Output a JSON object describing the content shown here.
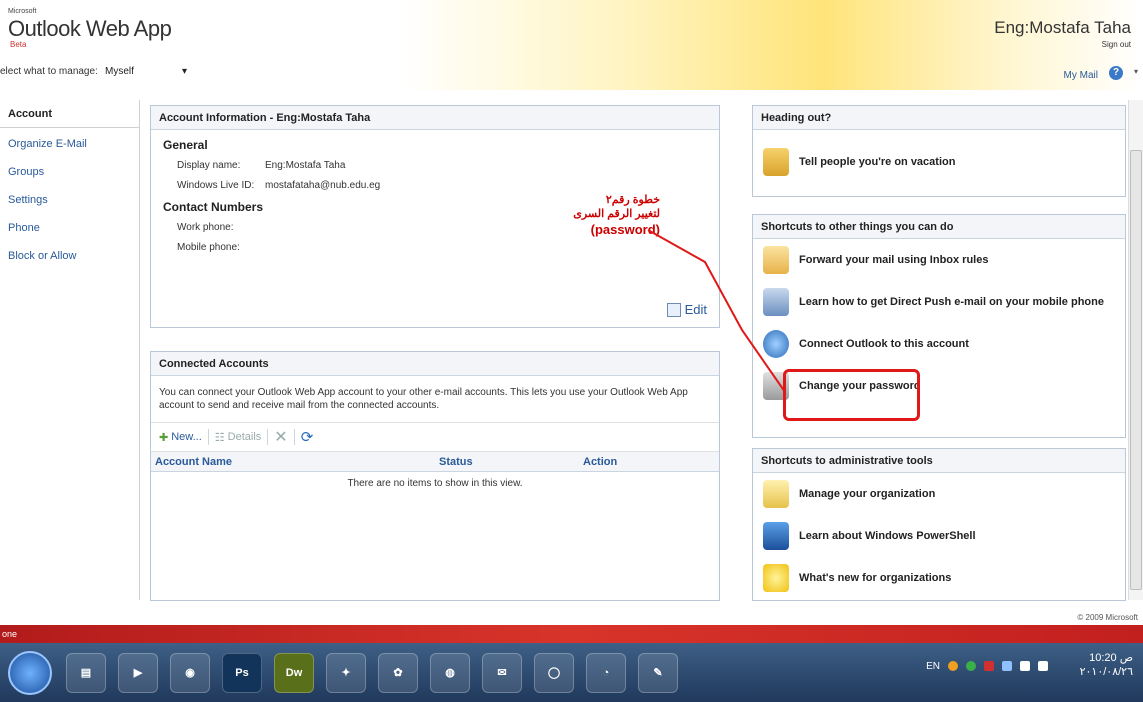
{
  "header": {
    "ms_label": "Microsoft",
    "app_title": "Outlook Web App",
    "beta": "Beta",
    "user_name": "Eng:Mostafa Taha",
    "sign_out": "Sign out",
    "manage_label": "elect what to manage:",
    "manage_value": "Myself",
    "my_mail": "My Mail"
  },
  "sidebar": {
    "items": [
      {
        "label": "Account"
      },
      {
        "label": "Organize E-Mail"
      },
      {
        "label": "Groups"
      },
      {
        "label": "Settings"
      },
      {
        "label": "Phone"
      },
      {
        "label": "Block or Allow"
      }
    ]
  },
  "account_info": {
    "title": "Account Information - Eng:Mostafa Taha",
    "general": "General",
    "display_name_label": "Display name:",
    "display_name_value": "Eng:Mostafa Taha",
    "live_id_label": "Windows Live ID:",
    "live_id_value": "mostafataha@nub.edu.eg",
    "contact_numbers": "Contact Numbers",
    "work_phone_label": "Work phone:",
    "mobile_phone_label": "Mobile phone:",
    "edit": "Edit"
  },
  "connected": {
    "title": "Connected Accounts",
    "description": "You can connect your Outlook Web App account to your other e-mail accounts. This lets you use your Outlook Web App account to send and receive mail from the connected accounts.",
    "new": "New...",
    "details": "Details",
    "columns": [
      "Account Name",
      "Status",
      "Action"
    ],
    "empty": "There are no items to show in this view."
  },
  "heading_out": {
    "title": "Heading out?",
    "item": "Tell people you're on vacation"
  },
  "shortcuts": {
    "title": "Shortcuts to other things you can do",
    "items": [
      "Forward your mail using Inbox rules",
      "Learn how to get Direct Push e-mail on your mobile phone",
      "Connect Outlook to this account",
      "Change your password"
    ]
  },
  "admin": {
    "title": "Shortcuts to administrative tools",
    "items": [
      "Manage your organization",
      "Learn about Windows PowerShell",
      "What's new for organizations"
    ]
  },
  "annotation": {
    "line1": "خطوة رقم٢",
    "line2": "لتغيير الرقم السرى",
    "line3": "(password)"
  },
  "footer": {
    "copyright": "© 2009 Microsoft",
    "status": "one"
  },
  "taskbar": {
    "lang": "EN",
    "time": "10:20 ص",
    "date": "٢٠١٠/٠٨/٢٦"
  },
  "colors": {
    "accent": "#2a5a9a",
    "annotation_red": "#e01818"
  }
}
